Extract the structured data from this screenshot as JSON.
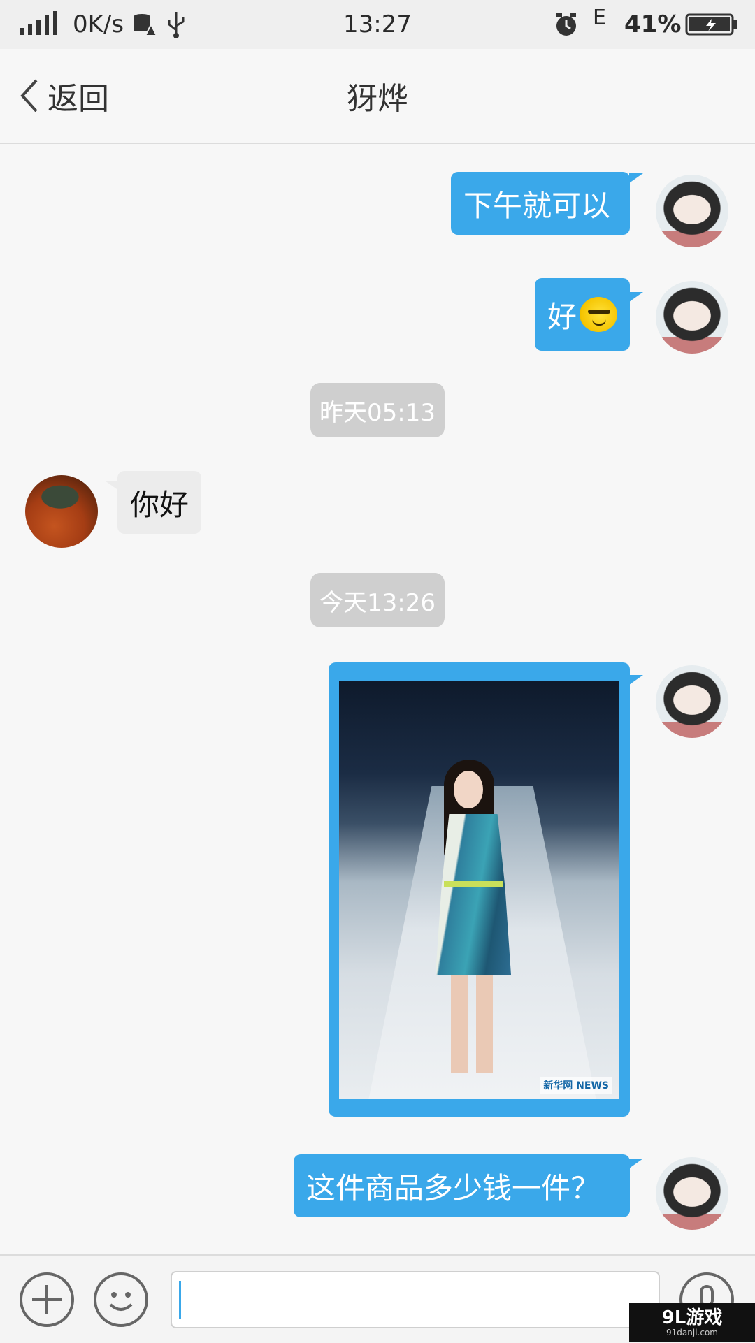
{
  "status_bar": {
    "net_speed": "0K/s",
    "time": "13:27",
    "network_type": "E",
    "battery": "41%"
  },
  "nav": {
    "back_label": "返回",
    "title": "犽烨"
  },
  "messages": [
    {
      "from": "me",
      "text": "下午就可以"
    },
    {
      "from": "me",
      "text": "好",
      "emoji": "smug-face-emoji"
    },
    {
      "type": "timestamp",
      "text": "昨天05:13"
    },
    {
      "from": "other",
      "text": "你好"
    },
    {
      "type": "timestamp",
      "text": "今天13:26"
    },
    {
      "from": "me",
      "type": "image",
      "watermark": "新华网 NEWS"
    },
    {
      "from": "me",
      "text": "这件商品多少钱一件？"
    }
  ],
  "input": {
    "value": "",
    "placeholder": ""
  },
  "corner_logo": {
    "main": "9L游戏",
    "sub": "91danji.com"
  },
  "colors": {
    "my_bubble": "#3aa8ea",
    "other_bubble": "#ececec",
    "timestamp_bg": "#cfcfcf"
  }
}
